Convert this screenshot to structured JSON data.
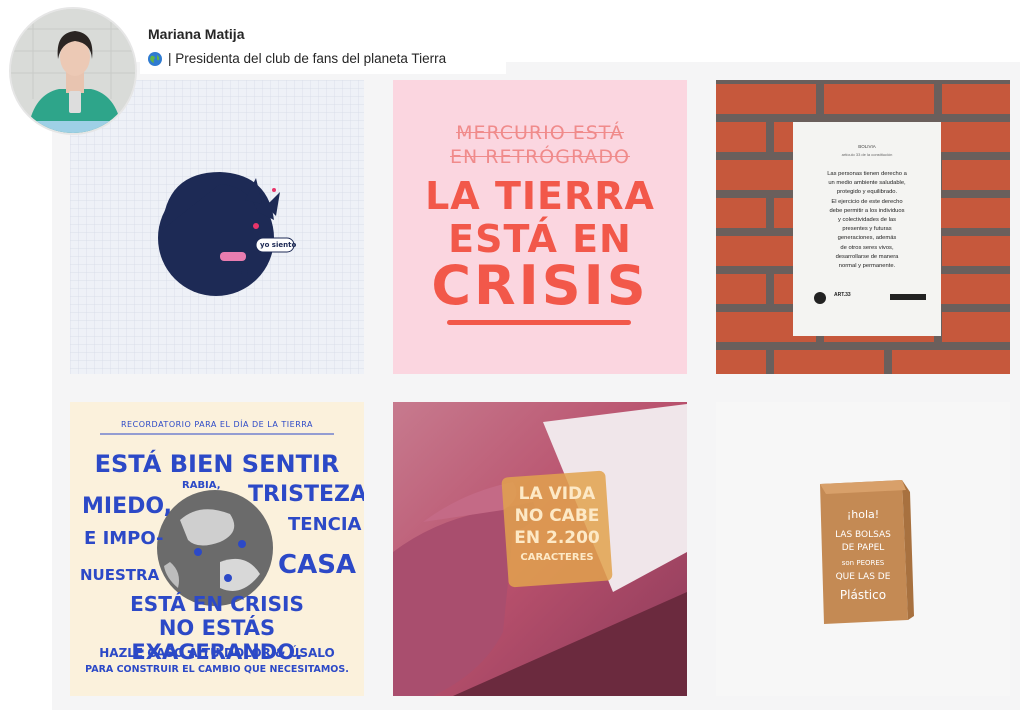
{
  "profile": {
    "name": "Mariana Matija",
    "bio_icon": "globe-icon",
    "bio": "| Presidenta del club de fans del planeta Tierra"
  },
  "posts": [
    {
      "kind": "illustration",
      "bubble_text": "yo siento"
    },
    {
      "kind": "lettering",
      "line_struck_1": "MERCURIO ESTÁ",
      "line_struck_2": "EN RETRÓGRADO",
      "line_1": "LA TIERRA",
      "line_2": "ESTÁ EN",
      "line_3": "CRISIS"
    },
    {
      "kind": "poster",
      "small_title": "BOLIVIA",
      "subtitle": "artículo 33 de la constitución",
      "body": [
        "Las personas tienen derecho a",
        "un medio ambiente saludable,",
        "protegido y equilibrado.",
        "El ejercicio de este derecho",
        "debe permitir a los individuos",
        "y colectividades de las",
        "presentes y futuras",
        "generaciones, además",
        "de otros seres vivos,",
        "desarrollarse de manera",
        "normal y permanente."
      ],
      "footer_tag": "ART.33"
    },
    {
      "kind": "lettering",
      "top": "RECORDATORIO PARA EL DÍA DE LA TIERRA",
      "l1": "ESTÁ BIEN SENTIR",
      "l2a": "MIEDO,",
      "l2b": "RABIA,",
      "l2c": "TRISTEZA",
      "l3a": "E IMPO-",
      "l3b": "TENCIA",
      "l4a": "NUESTRA",
      "l4b": "CASA",
      "l5": "ESTÁ EN CRISIS",
      "l6": "NO ESTÁS EXAGERANDO.",
      "l7": "HAZLE CASO A TU DOLOR & ÚSALO",
      "l8": "PARA CONSTRUIR EL CAMBIO QUE NECESITAMOS."
    },
    {
      "kind": "photo",
      "card_1": "LA VIDA",
      "card_2": "NO CABE",
      "card_3": "EN 2.200",
      "card_4": "CARACTERES"
    },
    {
      "kind": "illustration",
      "bag_1": "¡hola!",
      "bag_2": "LAS BOLSAS",
      "bag_3": "DE PAPEL",
      "bag_4": "son PEORES",
      "bag_5": "QUE LAS DE",
      "bag_6": "Plástico"
    }
  ]
}
